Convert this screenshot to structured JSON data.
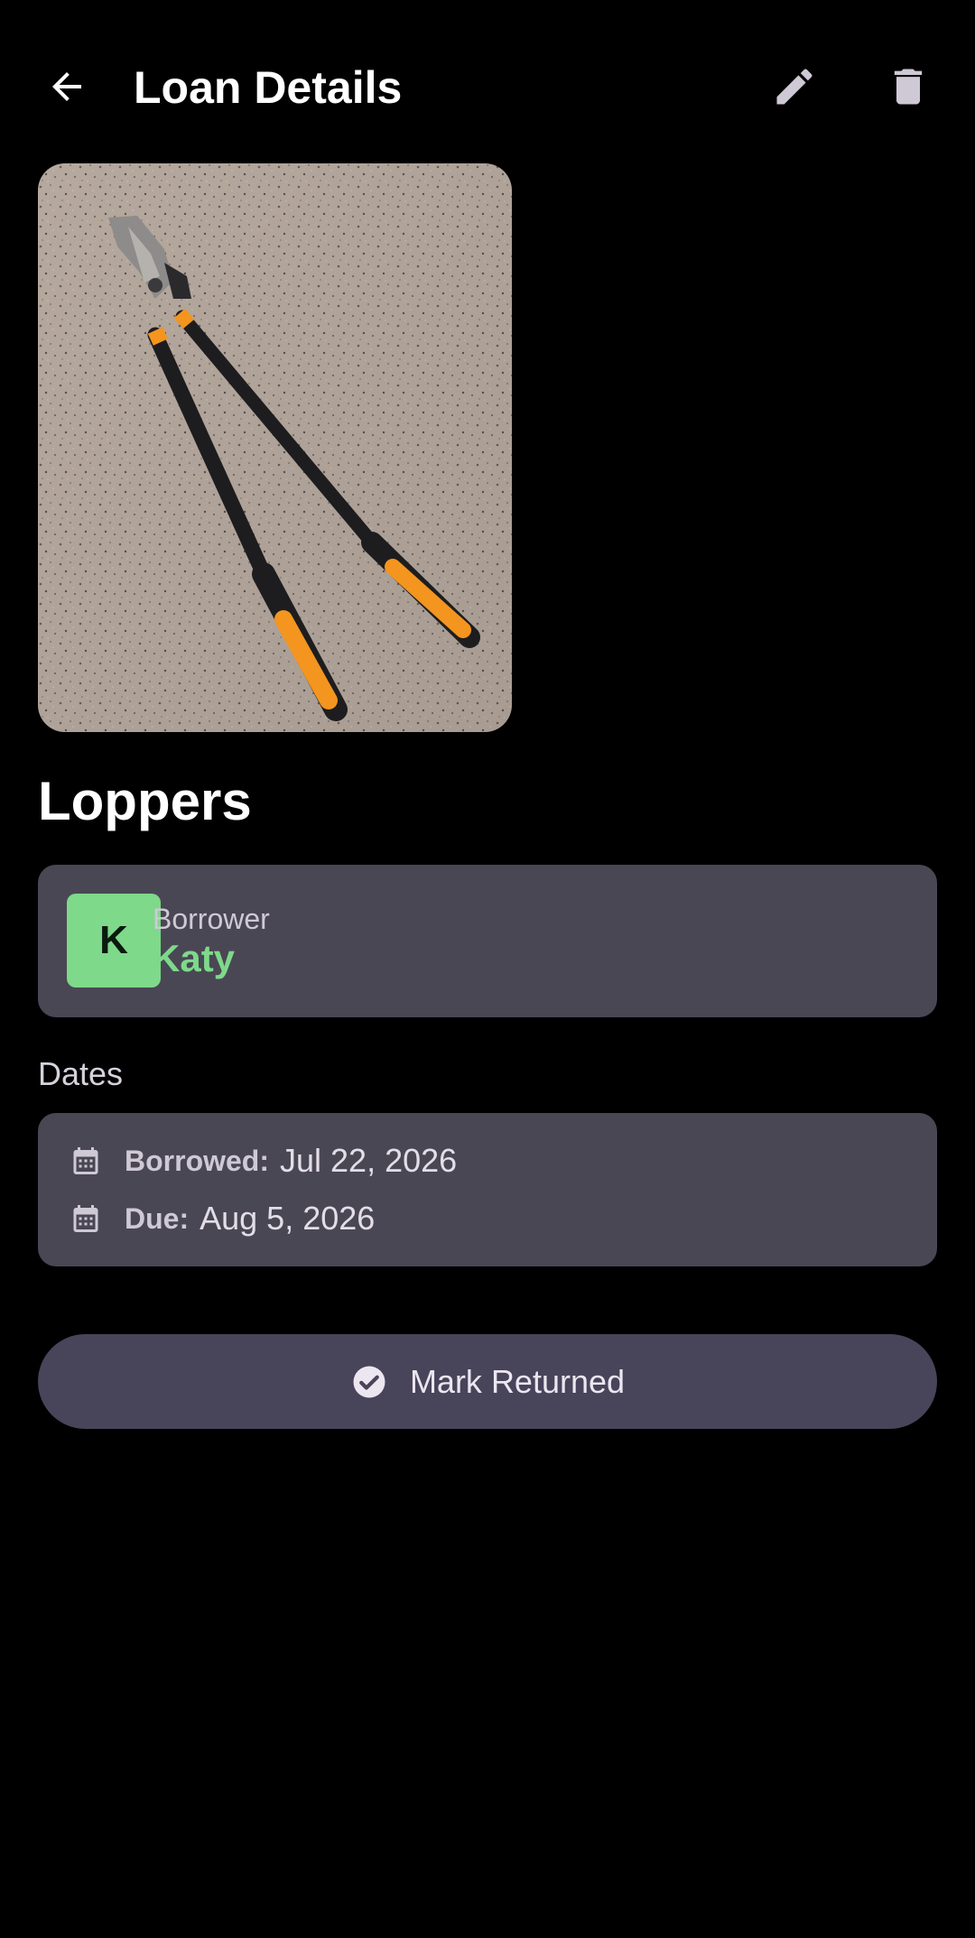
{
  "header": {
    "title": "Loan Details",
    "back_icon": "arrow-back-icon",
    "edit_icon": "pencil-icon",
    "delete_icon": "trash-icon"
  },
  "item": {
    "name": "Loppers",
    "photo_alt": "Loppers photo"
  },
  "borrower": {
    "label": "Borrower",
    "name": "Katy",
    "initial": "K",
    "avatar_color": "#7ed98a"
  },
  "dates": {
    "section_label": "Dates",
    "borrowed_label": "Borrowed:",
    "borrowed_value": "Jul 22, 2026",
    "due_label": "Due:",
    "due_value": "Aug 5, 2026",
    "icon": "calendar-icon"
  },
  "actions": {
    "mark_returned_label": "Mark Returned",
    "mark_returned_icon": "check-circle-icon"
  },
  "colors": {
    "background": "#000000",
    "card": "#4a4754",
    "accent": "#7ed98a",
    "button": "#48445a"
  }
}
